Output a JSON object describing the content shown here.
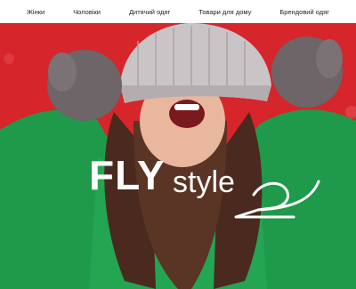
{
  "nav": {
    "items": [
      {
        "label": "Жінки"
      },
      {
        "label": "Чоловіки"
      },
      {
        "label": "Дитячий одяг"
      },
      {
        "label": "Товари для дому"
      },
      {
        "label": "Брендовий одяг"
      }
    ]
  },
  "hero": {
    "brand_part1": "FLY",
    "brand_part2": "style",
    "image_subject": "smiling woman in knit hat and mittens, green sweater",
    "background_color": "#d6252b",
    "sweater_color": "#1f9a4a",
    "hat_color": "#c9c5c7",
    "mitten_color": "#6d6568"
  }
}
